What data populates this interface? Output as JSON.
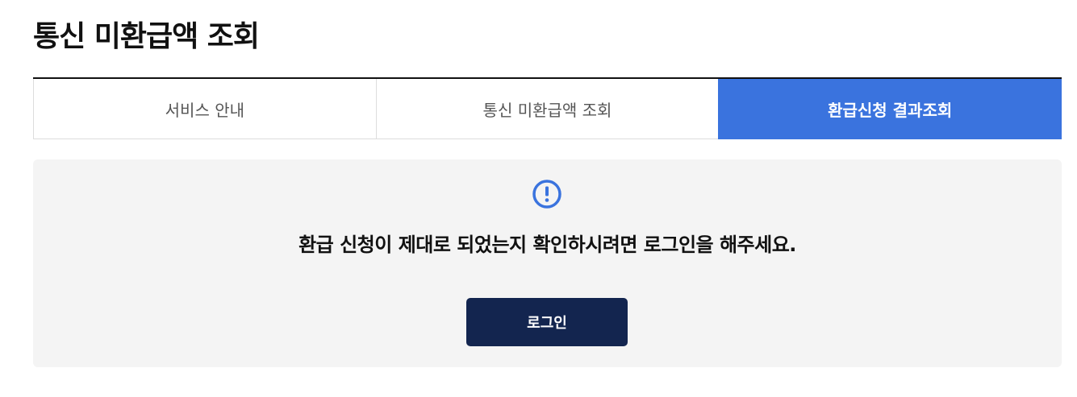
{
  "page": {
    "title": "통신 미환급액 조회"
  },
  "tabs": [
    {
      "label": "서비스 안내",
      "active": false
    },
    {
      "label": "통신 미환급액 조회",
      "active": false
    },
    {
      "label": "환급신청 결과조회",
      "active": true
    }
  ],
  "notice": {
    "icon": "exclamation-circle-icon",
    "message": "환급 신청이 제대로 되었는지 확인하시려면 로그인을 해주세요.",
    "login_label": "로그인"
  },
  "colors": {
    "accent": "#3a73de",
    "button": "#13254f",
    "panel": "#f4f4f4"
  }
}
